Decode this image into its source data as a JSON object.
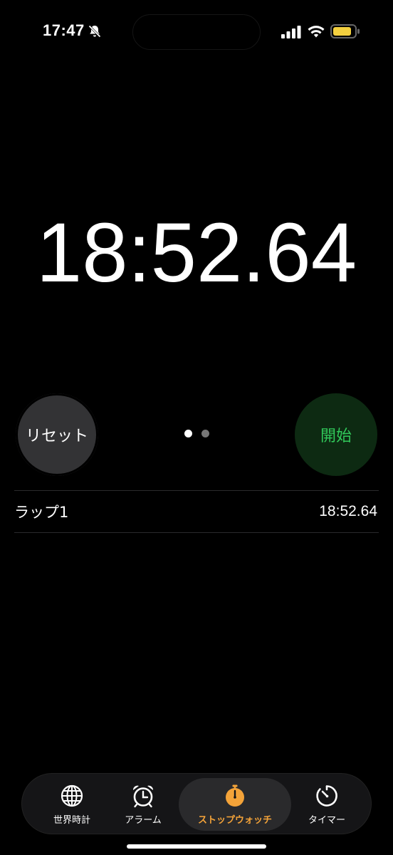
{
  "status_bar": {
    "time": "17:47"
  },
  "stopwatch": {
    "display": "18:52.64",
    "reset_label": "リセット",
    "start_label": "開始",
    "page_dots": {
      "count": 2,
      "active_index": 0
    }
  },
  "laps": [
    {
      "label": "ラップ1",
      "time": "18:52.64"
    }
  ],
  "tabs": [
    {
      "id": "world-clock",
      "label": "世界時計",
      "icon": "globe-icon",
      "selected": false
    },
    {
      "id": "alarm",
      "label": "アラーム",
      "icon": "alarm-clock-icon",
      "selected": false
    },
    {
      "id": "stopwatch",
      "label": "ストップウォッチ",
      "icon": "stopwatch-icon",
      "selected": true
    },
    {
      "id": "timer",
      "label": "タイマー",
      "icon": "timer-icon",
      "selected": false
    }
  ],
  "colors": {
    "background": "#000000",
    "accent_selected_tab": "#f4a339",
    "start_text": "#31c95a",
    "start_bg": "#0d2a12",
    "reset_bg": "#333335",
    "battery_fill": "#f4d03f"
  }
}
